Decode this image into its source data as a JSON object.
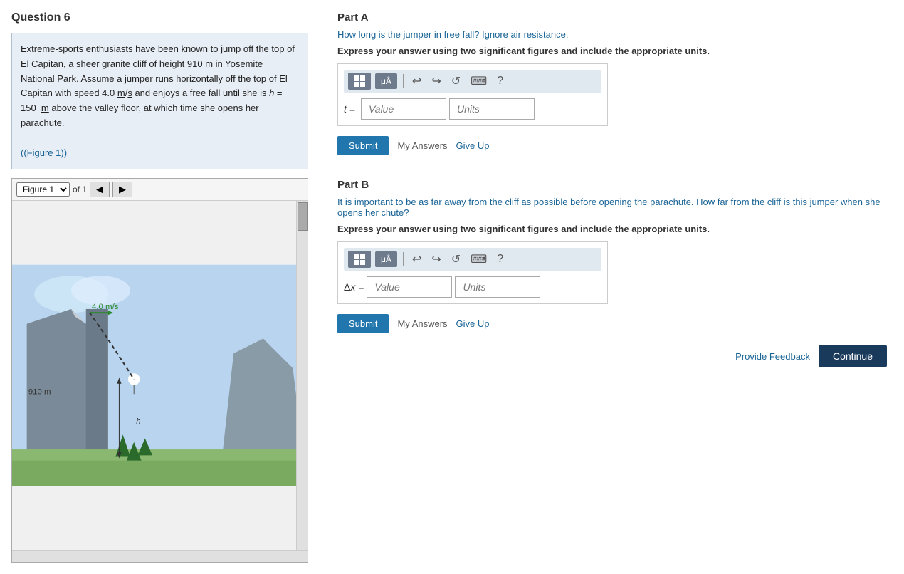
{
  "left": {
    "question_title": "Question 6",
    "question_text": "Extreme-sports enthusiasts have been known to jump off the top of El Capitan, a sheer granite cliff of height 910 m in Yosemite National Park. Assume a jumper runs horizontally off the top of El Capitan with speed 4.0 m/s and enjoys a free fall until she is h = 150  m above the valley floor, at which time she opens her parachute.",
    "figure_link": "(Figure 1)",
    "figure_label": "Figure 1",
    "of_label": "of 1"
  },
  "right": {
    "part_a": {
      "title": "Part A",
      "question": "How long is the jumper in free fall? Ignore air resistance.",
      "instruction": "Express your answer using two significant figures and include the appropriate units.",
      "label": "t =",
      "value_placeholder": "Value",
      "units_placeholder": "Units",
      "submit_label": "Submit",
      "my_answers_label": "My Answers",
      "give_up_label": "Give Up"
    },
    "part_b": {
      "title": "Part B",
      "question": "It is important to be as far away from the cliff as possible before opening the parachute. How far from the cliff is this jumper when she opens her chute?",
      "instruction": "Express your answer using two significant figures and include the appropriate units.",
      "label": "Δx =",
      "value_placeholder": "Value",
      "units_placeholder": "Units",
      "submit_label": "Submit",
      "my_answers_label": "My Answers",
      "give_up_label": "Give Up"
    },
    "provide_feedback_label": "Provide Feedback",
    "continue_label": "Continue"
  },
  "toolbar": {
    "undo": "↩",
    "redo": "↪",
    "reset": "↺",
    "keyboard": "⌨",
    "help": "?"
  }
}
